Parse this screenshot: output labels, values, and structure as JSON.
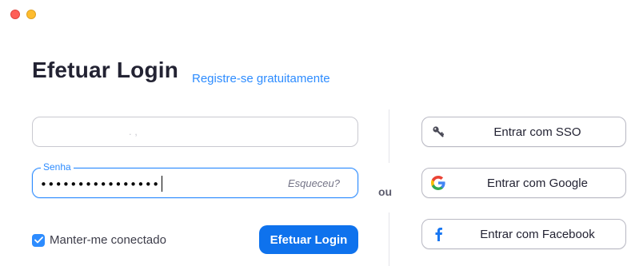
{
  "window": {
    "controls": [
      "close",
      "minimize"
    ]
  },
  "header": {
    "title": "Efetuar Login",
    "register_link": "Registre-se gratuitamente"
  },
  "form": {
    "email": {
      "value": ". ,"
    },
    "password": {
      "label": "Senha",
      "value": "••••••••••••••••",
      "forgot_link": "Esqueceu?"
    },
    "remember": {
      "label": "Manter-me conectado",
      "checked": true
    },
    "login_button": "Efetuar Login"
  },
  "divider": {
    "label": "ou"
  },
  "alternatives": {
    "sso": {
      "label": "Entrar com SSO",
      "icon": "key-icon"
    },
    "google": {
      "label": "Entrar com Google",
      "icon": "google-icon"
    },
    "facebook": {
      "label": "Entrar com Facebook",
      "icon": "facebook-icon"
    }
  },
  "colors": {
    "accent": "#2d8cff",
    "primary_button": "#0e72ed",
    "title": "#232333",
    "facebook": "#1877f2"
  }
}
